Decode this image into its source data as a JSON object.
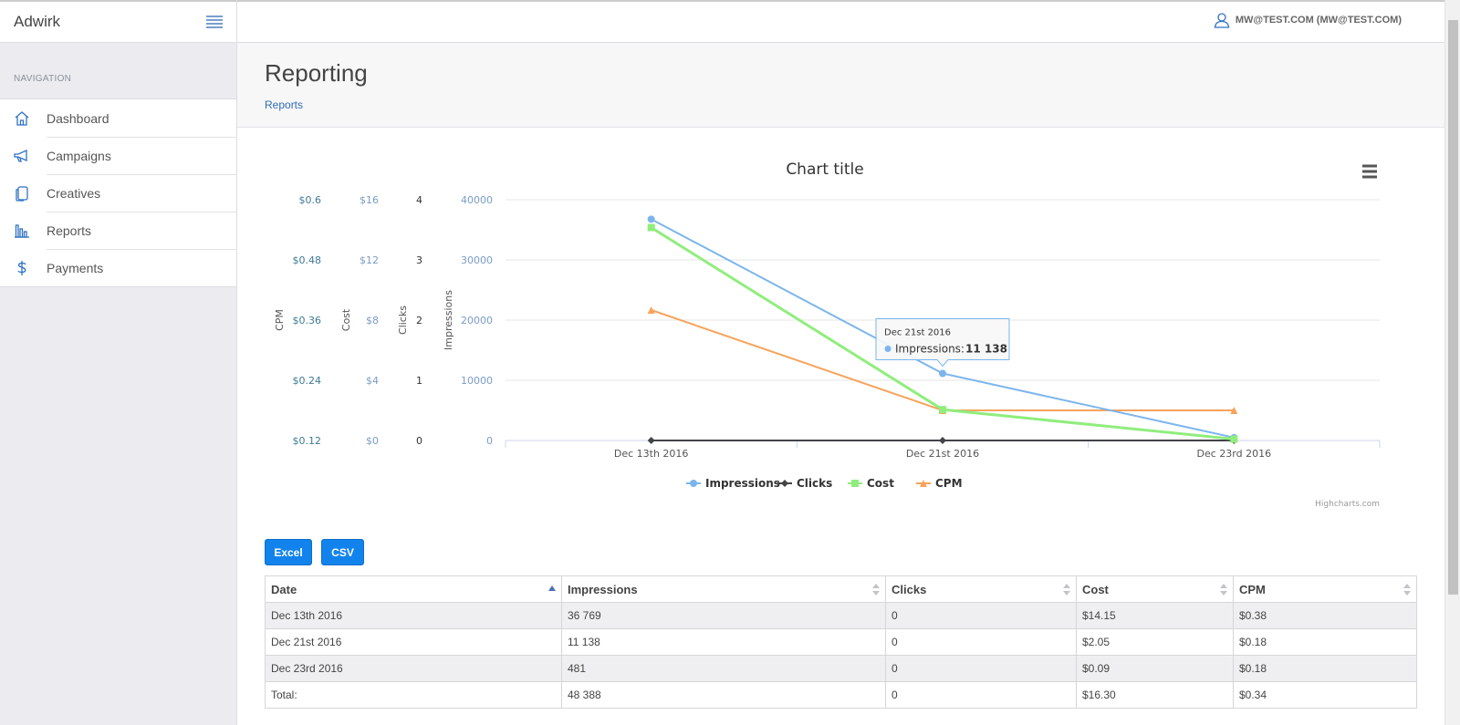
{
  "app": {
    "brand": "Adwirk"
  },
  "user": {
    "label": "MW@TEST.COM (MW@TEST.COM)"
  },
  "sidebar": {
    "heading": "NAVIGATION",
    "items": [
      {
        "label": "Dashboard",
        "icon": "home-icon"
      },
      {
        "label": "Campaigns",
        "icon": "megaphone-icon"
      },
      {
        "label": "Creatives",
        "icon": "copy-icon"
      },
      {
        "label": "Reports",
        "icon": "bar-chart-icon"
      },
      {
        "label": "Payments",
        "icon": "dollar-icon"
      }
    ]
  },
  "page": {
    "title": "Reporting",
    "breadcrumb": "Reports"
  },
  "chart_data": {
    "type": "line",
    "title": "Chart title",
    "x": [
      "Dec 13th 2016",
      "Dec 21st 2016",
      "Dec 23rd 2016"
    ],
    "axes": [
      {
        "label": "Impressions",
        "ticks": [
          "0",
          "10000",
          "20000",
          "30000",
          "40000"
        ],
        "range": [
          0,
          40000
        ]
      },
      {
        "label": "Clicks",
        "ticks": [
          "0",
          "1",
          "2",
          "3",
          "4"
        ],
        "range": [
          0,
          4
        ]
      },
      {
        "label": "Cost",
        "ticks": [
          "$0",
          "$4",
          "$8",
          "$12",
          "$16"
        ],
        "range": [
          0,
          16
        ]
      },
      {
        "label": "CPM",
        "ticks": [
          "$0.12",
          "$0.24",
          "$0.36",
          "$0.48",
          "$0.6"
        ],
        "range": [
          0.12,
          0.6
        ]
      }
    ],
    "series": [
      {
        "name": "Impressions",
        "values": [
          36769,
          11138,
          481
        ],
        "color": "#7cb5ec",
        "marker": "circle"
      },
      {
        "name": "Clicks",
        "values": [
          0,
          0,
          0
        ],
        "color": "#434348",
        "marker": "diamond"
      },
      {
        "name": "Cost",
        "values": [
          14.15,
          2.05,
          0.09
        ],
        "color": "#90ed7d",
        "marker": "square"
      },
      {
        "name": "CPM",
        "values": [
          0.38,
          0.18,
          0.18
        ],
        "color": "#f7a35c",
        "marker": "triangle"
      }
    ],
    "tooltip": {
      "header": "Dec 21st 2016",
      "series": "Impressions",
      "value": "11 138"
    },
    "credits": "Highcharts.com",
    "legend_position": "bottom-center",
    "grid": true
  },
  "export": {
    "excel": "Excel",
    "csv": "CSV"
  },
  "table": {
    "headers": [
      "Date",
      "Impressions",
      "Clicks",
      "Cost",
      "CPM"
    ],
    "rows": [
      [
        "Dec 13th 2016",
        "36 769",
        "0",
        "$14.15",
        "$0.38"
      ],
      [
        "Dec 21st 2016",
        "11 138",
        "0",
        "$2.05",
        "$0.18"
      ],
      [
        "Dec 23rd 2016",
        "481",
        "0",
        "$0.09",
        "$0.18"
      ],
      [
        "Total:",
        "48 388",
        "0",
        "$16.30",
        "$0.34"
      ]
    ]
  }
}
